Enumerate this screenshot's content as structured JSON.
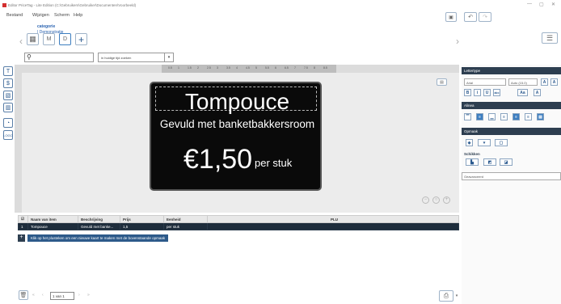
{
  "window": {
    "title": "Editor PriceTag - Lite Edition (C:\\Gebruikers\\Gebruiker\\Documenten\\Voorbeeld)",
    "min": "—",
    "max": "▢",
    "close": "✕"
  },
  "menu": [
    "Bestand",
    "Wijzigen",
    "Scherm",
    "Help"
  ],
  "breadcrumb": {
    "category_label": "categorie",
    "separator": "|",
    "category_value": "Demonstratie"
  },
  "toolbar": {
    "search_value": "",
    "sort_option": "in huidige tijd zoeken"
  },
  "card": {
    "name": "Tompouce",
    "description": "Gevuld met banketbakkersroom",
    "price": "€1,50",
    "unit": "per stuk"
  },
  "panel": {
    "lettertype": "Lettertype",
    "font_name": "Arial",
    "font_size": "Auto (15.0)",
    "alinea": "Alinea",
    "opmaak": "Opmaak",
    "schikken": "Schikken",
    "geavanceerd": "Geavanceerd",
    "bold": "B",
    "italic": "i",
    "underline": "U",
    "strike": "abc",
    "aa": "Aa",
    "fontA": "A"
  },
  "table": {
    "headers": [
      "Naam van item",
      "Beschrijving",
      "Prijs",
      "Eenheid",
      "PLU"
    ],
    "rows": [
      {
        "num": "1",
        "name": "Tompouce",
        "description": "Gevuld met banke...",
        "price": "1,5",
        "unit": "per stuk",
        "plu": ""
      }
    ]
  },
  "hint": "Klik op het plusteken om een nieuwe kaart te maken met de bovenstaande opmaak",
  "pager": {
    "first": "«",
    "prev": "‹",
    "page_text": "1 van 1",
    "next": "›",
    "last": "»"
  },
  "ruler_labels": [
    "0.5",
    "1",
    "1.5",
    "2",
    "2.5",
    "3",
    "3.5",
    "4",
    "4.5",
    "5",
    "5.5",
    "6",
    "6.5",
    "7",
    "7.5",
    "8",
    "8.5"
  ],
  "colors": {
    "accent": "#2d3e50",
    "link": "#2a63b0",
    "card_bg": "#0a0a0a"
  }
}
